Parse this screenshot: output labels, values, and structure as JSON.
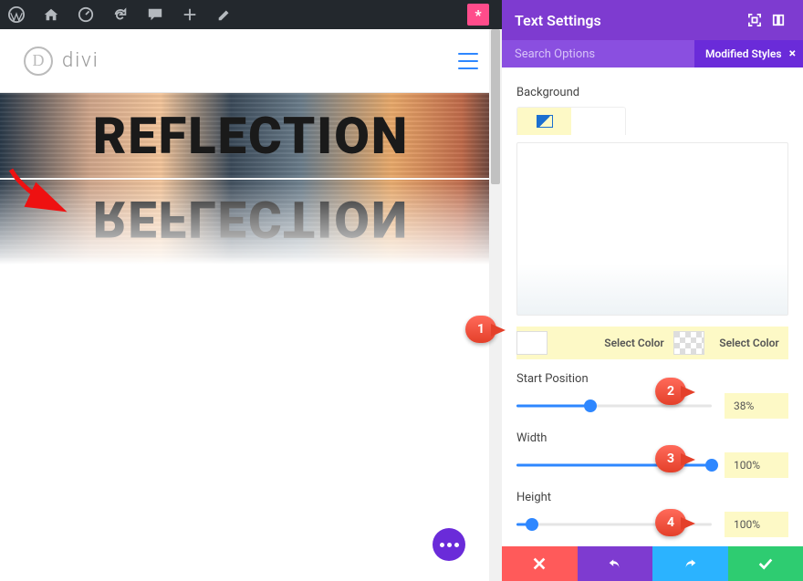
{
  "adminbar": {
    "badge": "*"
  },
  "site": {
    "logo_letter": "D",
    "logo_text": "divi"
  },
  "hero": {
    "text": "REFLECTION"
  },
  "panel": {
    "title": "Text Settings",
    "search_placeholder": "Search Options",
    "filter_label": "Modified Styles",
    "filter_close": "×"
  },
  "fields": {
    "background_label": "Background",
    "select_color_1": "Select Color",
    "select_color_2": "Select Color",
    "start_position": {
      "label": "Start Position",
      "value": "38%",
      "pct": 38
    },
    "width": {
      "label": "Width",
      "value": "100%",
      "pct": 100
    },
    "height": {
      "label": "Height",
      "value": "100%",
      "pct": 8
    }
  },
  "callouts": {
    "c1": "1",
    "c2": "2",
    "c3": "3",
    "c4": "4"
  }
}
